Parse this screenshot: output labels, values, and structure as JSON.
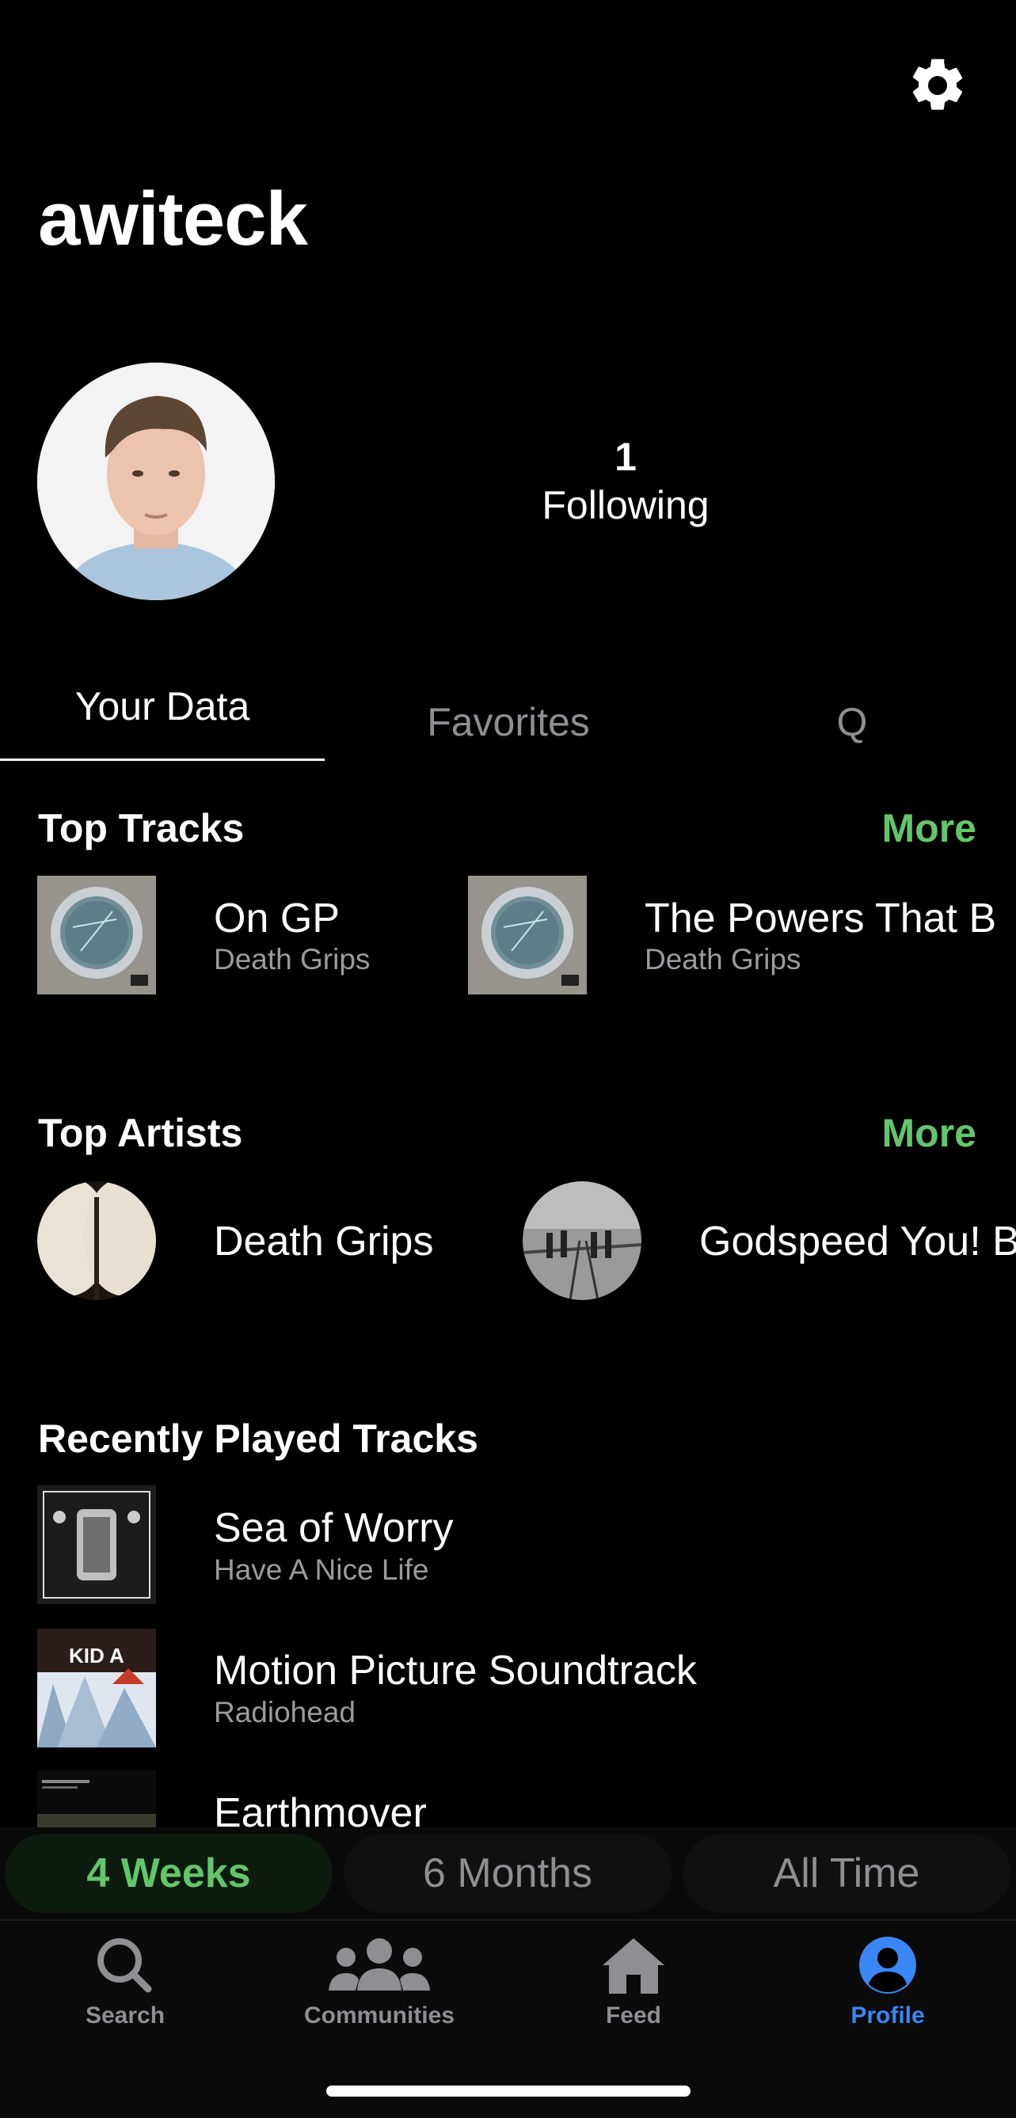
{
  "header": {
    "username": "awiteck",
    "settings_icon": "gear-icon"
  },
  "profile": {
    "following_count": "1",
    "following_label": "Following",
    "avatar_icon": "avatar"
  },
  "tabs": [
    {
      "label": "Your Data",
      "active": true
    },
    {
      "label": "Favorites",
      "active": false
    },
    {
      "label": "Q",
      "active": false
    }
  ],
  "top_tracks": {
    "title": "Top Tracks",
    "more": "More",
    "items": [
      {
        "title": "On GP",
        "artist": "Death Grips"
      },
      {
        "title": "The Powers That B",
        "artist": "Death Grips"
      }
    ]
  },
  "top_artists": {
    "title": "Top Artists",
    "more": "More",
    "items": [
      {
        "name": "Death Grips"
      },
      {
        "name": "Godspeed You! Bl"
      }
    ]
  },
  "recent_tracks": {
    "title": "Recently Played Tracks",
    "items": [
      {
        "title": "Sea of Worry",
        "artist": "Have A Nice Life"
      },
      {
        "title": "Motion Picture Soundtrack",
        "artist": "Radiohead"
      },
      {
        "title": "Earthmover",
        "artist": ""
      }
    ]
  },
  "kid_a_cover_text": "KID A",
  "time_range": {
    "options": [
      "4 Weeks",
      "6 Months",
      "All Time"
    ],
    "selected": "4 Weeks"
  },
  "nav": [
    {
      "label": "Search",
      "icon": "search-icon",
      "active": false
    },
    {
      "label": "Communities",
      "icon": "people-icon",
      "active": false
    },
    {
      "label": "Feed",
      "icon": "home-icon",
      "active": false
    },
    {
      "label": "Profile",
      "icon": "profile-icon",
      "active": true
    }
  ],
  "colors": {
    "accent_green": "#63c66a",
    "active_blue": "#3a86f5",
    "inactive_gray": "#8e8e93",
    "background": "#000000"
  }
}
